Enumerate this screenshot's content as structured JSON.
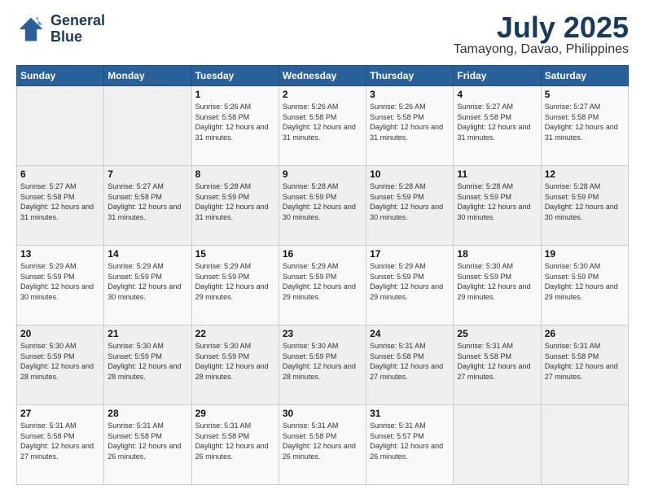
{
  "header": {
    "logo_line1": "General",
    "logo_line2": "Blue",
    "main_title": "July 2025",
    "subtitle": "Tamayong, Davao, Philippines"
  },
  "weekdays": [
    "Sunday",
    "Monday",
    "Tuesday",
    "Wednesday",
    "Thursday",
    "Friday",
    "Saturday"
  ],
  "weeks": [
    [
      {
        "day": "",
        "info": ""
      },
      {
        "day": "",
        "info": ""
      },
      {
        "day": "1",
        "info": "Sunrise: 5:26 AM\nSunset: 5:58 PM\nDaylight: 12 hours and 31 minutes."
      },
      {
        "day": "2",
        "info": "Sunrise: 5:26 AM\nSunset: 5:58 PM\nDaylight: 12 hours and 31 minutes."
      },
      {
        "day": "3",
        "info": "Sunrise: 5:26 AM\nSunset: 5:58 PM\nDaylight: 12 hours and 31 minutes."
      },
      {
        "day": "4",
        "info": "Sunrise: 5:27 AM\nSunset: 5:58 PM\nDaylight: 12 hours and 31 minutes."
      },
      {
        "day": "5",
        "info": "Sunrise: 5:27 AM\nSunset: 5:58 PM\nDaylight: 12 hours and 31 minutes."
      }
    ],
    [
      {
        "day": "6",
        "info": "Sunrise: 5:27 AM\nSunset: 5:58 PM\nDaylight: 12 hours and 31 minutes."
      },
      {
        "day": "7",
        "info": "Sunrise: 5:27 AM\nSunset: 5:58 PM\nDaylight: 12 hours and 31 minutes."
      },
      {
        "day": "8",
        "info": "Sunrise: 5:28 AM\nSunset: 5:59 PM\nDaylight: 12 hours and 31 minutes."
      },
      {
        "day": "9",
        "info": "Sunrise: 5:28 AM\nSunset: 5:59 PM\nDaylight: 12 hours and 30 minutes."
      },
      {
        "day": "10",
        "info": "Sunrise: 5:28 AM\nSunset: 5:59 PM\nDaylight: 12 hours and 30 minutes."
      },
      {
        "day": "11",
        "info": "Sunrise: 5:28 AM\nSunset: 5:59 PM\nDaylight: 12 hours and 30 minutes."
      },
      {
        "day": "12",
        "info": "Sunrise: 5:28 AM\nSunset: 5:59 PM\nDaylight: 12 hours and 30 minutes."
      }
    ],
    [
      {
        "day": "13",
        "info": "Sunrise: 5:29 AM\nSunset: 5:59 PM\nDaylight: 12 hours and 30 minutes."
      },
      {
        "day": "14",
        "info": "Sunrise: 5:29 AM\nSunset: 5:59 PM\nDaylight: 12 hours and 30 minutes."
      },
      {
        "day": "15",
        "info": "Sunrise: 5:29 AM\nSunset: 5:59 PM\nDaylight: 12 hours and 29 minutes."
      },
      {
        "day": "16",
        "info": "Sunrise: 5:29 AM\nSunset: 5:59 PM\nDaylight: 12 hours and 29 minutes."
      },
      {
        "day": "17",
        "info": "Sunrise: 5:29 AM\nSunset: 5:59 PM\nDaylight: 12 hours and 29 minutes."
      },
      {
        "day": "18",
        "info": "Sunrise: 5:30 AM\nSunset: 5:59 PM\nDaylight: 12 hours and 29 minutes."
      },
      {
        "day": "19",
        "info": "Sunrise: 5:30 AM\nSunset: 5:59 PM\nDaylight: 12 hours and 29 minutes."
      }
    ],
    [
      {
        "day": "20",
        "info": "Sunrise: 5:30 AM\nSunset: 5:59 PM\nDaylight: 12 hours and 28 minutes."
      },
      {
        "day": "21",
        "info": "Sunrise: 5:30 AM\nSunset: 5:59 PM\nDaylight: 12 hours and 28 minutes."
      },
      {
        "day": "22",
        "info": "Sunrise: 5:30 AM\nSunset: 5:59 PM\nDaylight: 12 hours and 28 minutes."
      },
      {
        "day": "23",
        "info": "Sunrise: 5:30 AM\nSunset: 5:59 PM\nDaylight: 12 hours and 28 minutes."
      },
      {
        "day": "24",
        "info": "Sunrise: 5:31 AM\nSunset: 5:58 PM\nDaylight: 12 hours and 27 minutes."
      },
      {
        "day": "25",
        "info": "Sunrise: 5:31 AM\nSunset: 5:58 PM\nDaylight: 12 hours and 27 minutes."
      },
      {
        "day": "26",
        "info": "Sunrise: 5:31 AM\nSunset: 5:58 PM\nDaylight: 12 hours and 27 minutes."
      }
    ],
    [
      {
        "day": "27",
        "info": "Sunrise: 5:31 AM\nSunset: 5:58 PM\nDaylight: 12 hours and 27 minutes."
      },
      {
        "day": "28",
        "info": "Sunrise: 5:31 AM\nSunset: 5:58 PM\nDaylight: 12 hours and 26 minutes."
      },
      {
        "day": "29",
        "info": "Sunrise: 5:31 AM\nSunset: 5:58 PM\nDaylight: 12 hours and 26 minutes."
      },
      {
        "day": "30",
        "info": "Sunrise: 5:31 AM\nSunset: 5:58 PM\nDaylight: 12 hours and 26 minutes."
      },
      {
        "day": "31",
        "info": "Sunrise: 5:31 AM\nSunset: 5:57 PM\nDaylight: 12 hours and 26 minutes."
      },
      {
        "day": "",
        "info": ""
      },
      {
        "day": "",
        "info": ""
      }
    ]
  ]
}
